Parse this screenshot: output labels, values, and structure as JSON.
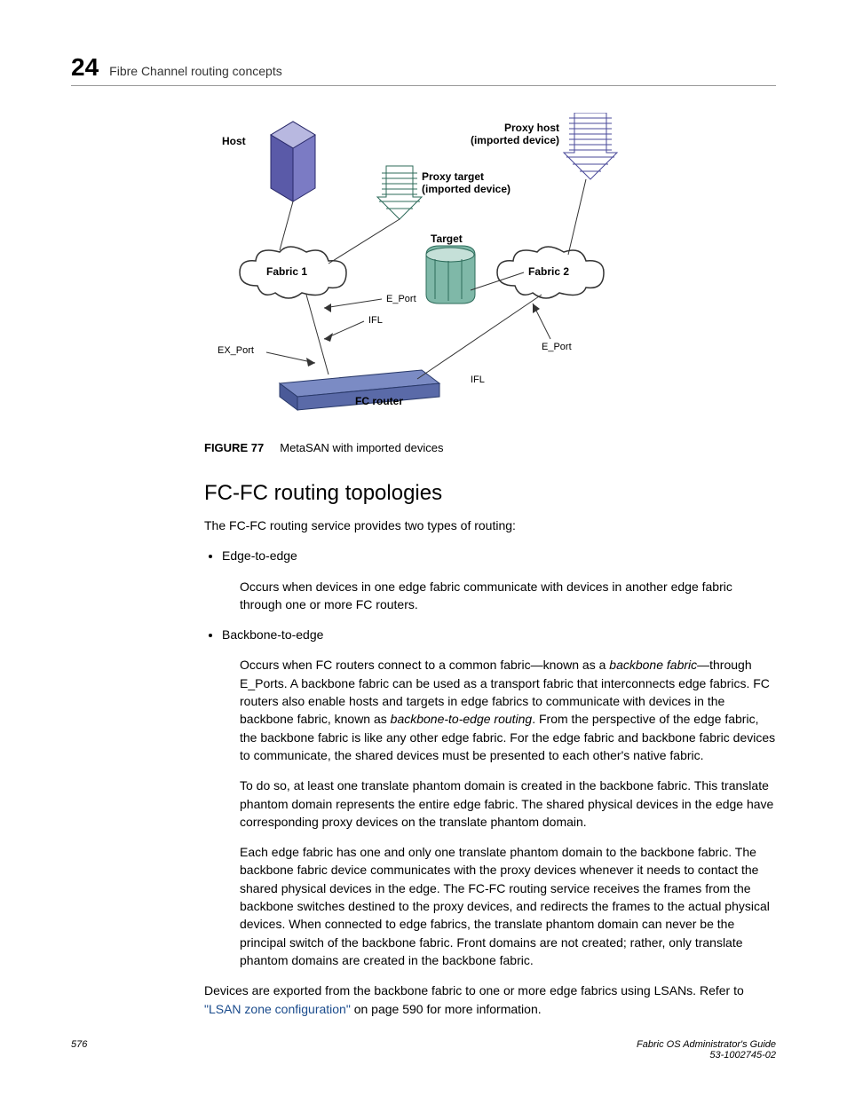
{
  "header": {
    "chapter": "24",
    "title": "Fibre Channel routing concepts"
  },
  "figure": {
    "labels": {
      "host": "Host",
      "proxy_host_l1": "Proxy host",
      "proxy_host_l2": "(imported device)",
      "proxy_target_l1": "Proxy target",
      "proxy_target_l2": "(imported device)",
      "target": "Target",
      "fabric1": "Fabric 1",
      "fabric2": "Fabric 2",
      "e_port": "E_Port",
      "ifl": "IFL",
      "ex_port": "EX_Port",
      "fc_router": "FC router"
    },
    "caption_num": "FIGURE 77",
    "caption_text": "MetaSAN with imported devices"
  },
  "section_heading": "FC-FC routing topologies",
  "intro": "The FC-FC routing service provides two types of routing:",
  "bullet1": "Edge-to-edge",
  "bullet1_desc": "Occurs when devices in one edge fabric communicate with devices in another edge fabric through one or more FC routers.",
  "bullet2": "Backbone-to-edge",
  "b2_p1a": "Occurs when FC routers connect to a common fabric—known as a ",
  "b2_p1b": "backbone fabric",
  "b2_p1c": "—through E_Ports. A backbone fabric can be used as a transport fabric that interconnects edge fabrics. FC routers also enable hosts and targets in edge fabrics to communicate with devices in the backbone fabric, known as ",
  "b2_p1d": "backbone-to-edge routing",
  "b2_p1e": ". From the perspective of the edge fabric, the backbone fabric is like any other edge fabric. For the edge fabric and backbone fabric devices to communicate, the shared devices must be presented to each other's native fabric.",
  "b2_p2": "To do so, at least one translate phantom domain is created in the backbone fabric. This translate phantom domain represents the entire edge fabric. The shared physical devices in the edge have corresponding proxy devices on the translate phantom domain.",
  "b2_p3": "Each edge fabric has one and only one translate phantom domain to the backbone fabric. The backbone fabric device communicates with the proxy devices whenever it needs to contact the shared physical devices in the edge. The FC-FC routing service receives the frames from the backbone switches destined to the proxy devices, and redirects the frames to the actual physical devices. When connected to edge fabrics, the translate phantom domain can never be the principal switch of the backbone fabric. Front domains are not created; rather, only translate phantom domains are created in the backbone fabric.",
  "closing_a": "Devices are exported from the backbone fabric to one or more edge fabrics using LSANs. Refer to ",
  "closing_link": "\"LSAN zone configuration\"",
  "closing_b": " on page 590 for more information.",
  "footer": {
    "page": "576",
    "guide": "Fabric OS Administrator's Guide",
    "doc": "53-1002745-02"
  }
}
